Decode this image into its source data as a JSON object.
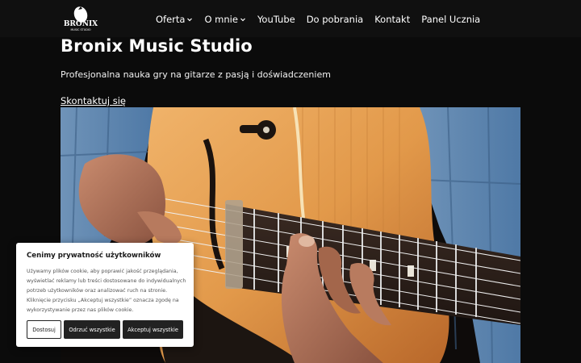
{
  "header": {
    "logo_text": "BRONIX",
    "logo_sub": "MUSIC STUDIO",
    "nav": [
      {
        "label": "Oferta",
        "dropdown": true
      },
      {
        "label": "O mnie",
        "dropdown": true
      },
      {
        "label": "YouTube",
        "dropdown": false
      },
      {
        "label": "Do pobrania",
        "dropdown": false
      },
      {
        "label": "Kontakt",
        "dropdown": false
      },
      {
        "label": "Panel Ucznia",
        "dropdown": false
      }
    ]
  },
  "hero": {
    "title": "Bronix Music Studio",
    "subtitle": "Profesjonalna nauka gry na gitarze z pasją i doświadczeniem",
    "cta": "Skontaktuj się"
  },
  "cookie": {
    "title": "Cenimy prywatność użytkowników",
    "text": "Używamy plików cookie, aby poprawić jakość przeglądania, wyświetlać reklamy lub treści dostosowane do indywidualnych potrzeb użytkowników oraz analizować ruch na stronie. Kliknięcie przycisku „Akceptuj wszystkie” oznacza zgodę na wykorzystywanie przez nas plików cookie.",
    "buttons": {
      "customize": "Dostosuj",
      "reject": "Odrzuć wszystkie",
      "accept": "Akceptuj wszystkie"
    }
  },
  "colors": {
    "background": "#0b0b0b",
    "navbar": "#101010",
    "button_dark": "#222222"
  }
}
